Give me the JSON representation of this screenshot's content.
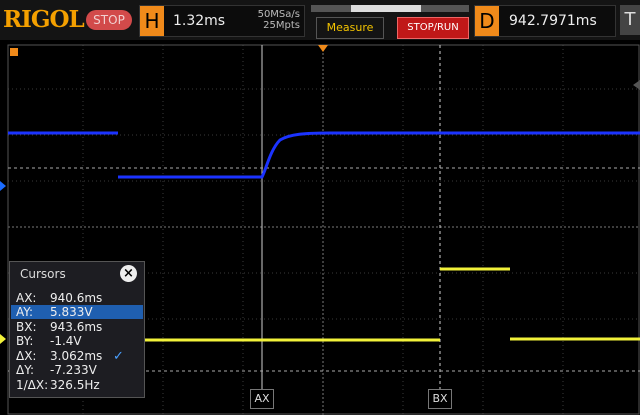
{
  "topbar": {
    "brand": "RIGOL",
    "run_state": "STOP",
    "horizontal": {
      "letter": "H",
      "timebase": "1.32ms",
      "sample_rate": "50MSa/s",
      "memory_depth": "25Mpts"
    },
    "measure_label": "Measure",
    "stoprun_label": "STOP/RUN",
    "delay": {
      "letter": "D",
      "value": "942.7971ms"
    },
    "trigger_letter": "T"
  },
  "cursors": {
    "title": "Cursors",
    "close_icon": "close-icon",
    "rows": [
      {
        "key": "AX:",
        "value": "940.6ms",
        "selected": false
      },
      {
        "key": "AY:",
        "value": "5.833V",
        "selected": true
      },
      {
        "key": "BX:",
        "value": "943.6ms",
        "selected": false
      },
      {
        "key": "BY:",
        "value": "-1.4V",
        "selected": false
      },
      {
        "key": "ΔX:",
        "value": "3.062ms",
        "selected": false
      },
      {
        "key": "ΔY:",
        "value": "-7.233V",
        "selected": false
      },
      {
        "key": "1/ΔX:",
        "value": "326.5Hz",
        "selected": false
      }
    ],
    "ax_label": "AX",
    "bx_label": "BX"
  },
  "colors": {
    "ch1": "#f2f23a",
    "ch2": "#1b33ff",
    "accent": "#f08a1a",
    "stop": "#c01818"
  }
}
